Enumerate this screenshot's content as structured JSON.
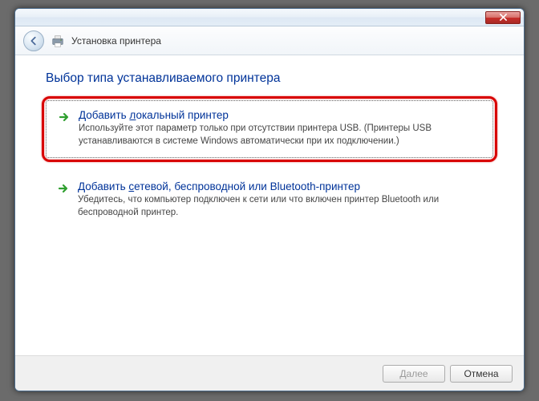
{
  "window": {
    "title": "Установка принтера"
  },
  "heading": "Выбор типа устанавливаемого принтера",
  "options": [
    {
      "title_pre": "Добавить ",
      "title_ul": "л",
      "title_post": "окальный принтер",
      "desc": "Используйте этот параметр только при отсутствии принтера USB. (Принтеры USB устанавливаются в системе Windows автоматически при их подключении.)"
    },
    {
      "title_pre": "Добавить ",
      "title_ul": "с",
      "title_post": "етевой, беспроводной или Bluetooth-принтер",
      "desc": "Убедитесь, что компьютер подключен к сети или что включен принтер Bluetooth или беспроводной принтер."
    }
  ],
  "footer": {
    "next_ul": "Д",
    "next_post": "алее",
    "cancel": "Отмена"
  }
}
